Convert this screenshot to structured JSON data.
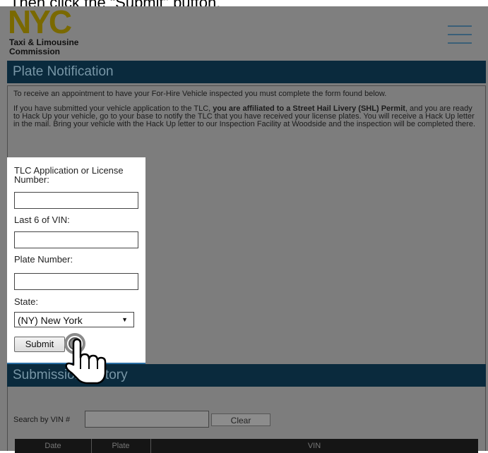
{
  "caption": "Then click the “Submit” button.",
  "header": {
    "logo_word": "NYC",
    "logo_line1": "Taxi & Limousine",
    "logo_line2": "Commission",
    "menu_icon": "hamburger-menu-icon"
  },
  "plate_section": {
    "title": "Plate Notification",
    "intro_1": "To receive an appointment to have your For-Hire Vehicle inspected you must complete the form found below.",
    "intro_2_a": "If you have submitted your vehicle application to the TLC, ",
    "intro_2_bold": "you are affiliated to a Street Hail Livery (SHL) Permit",
    "intro_2_b": ", and you are ready to Hack Up your vehicle, go to your base to notify the TLC that you have received your license plates. You will receive a Hack Up letter in the mail. Bring your vehicle with the Hack Up letter to our Inspection Facility at Woodside and the inspection will be completed there."
  },
  "form": {
    "license_label": "TLC Application or License Number:",
    "license_value": "",
    "vin_label": "Last 6 of VIN:",
    "vin_value": "",
    "plate_label": "Plate Number:",
    "plate_value": "",
    "state_label": "State:",
    "state_value": "(NY) New York",
    "submit_label": "Submit"
  },
  "history": {
    "title": "Submission History",
    "search_label": "Search by VIN #",
    "search_value": "",
    "clear_label": "Clear",
    "columns": [
      "Date",
      "Plate",
      "VIN"
    ]
  },
  "colors": {
    "band": "#0a2a3d",
    "overlay": "#7d7d7d",
    "accent": "#2b6fa5"
  }
}
